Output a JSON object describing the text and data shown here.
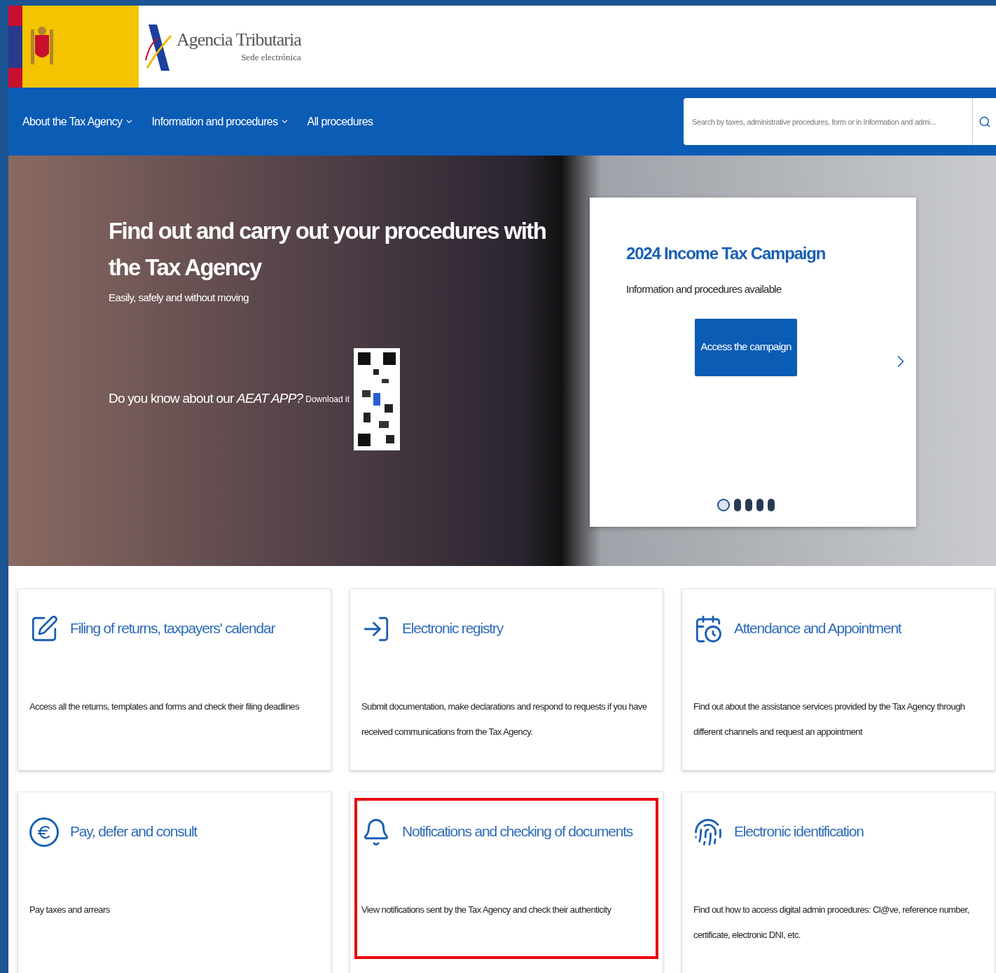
{
  "header": {
    "logo_title": "Agencia Tributaria",
    "logo_subtitle": "Sede electrónica"
  },
  "nav": {
    "items": [
      {
        "label": "About the Tax Agency",
        "has_dropdown": true
      },
      {
        "label": "Information and procedures",
        "has_dropdown": true
      },
      {
        "label": "All procedures",
        "has_dropdown": false
      }
    ],
    "search": {
      "placeholder": "Search by taxes, administrative procedures, form or in Information and admi..."
    }
  },
  "hero": {
    "title": "Find out and carry out your procedures with the Tax Agency",
    "subtitle": "Easily, safely and without moving",
    "app_prompt": "Do you know about our *AEAT APP?*",
    "download": "Download it",
    "campaign": {
      "title": "2024 Income Tax Campaign",
      "text": "Information and procedures available",
      "button": "Access the campaign",
      "dots": [
        {
          "selected": true
        },
        {
          "selected": false
        },
        {
          "selected": false
        },
        {
          "selected": false
        },
        {
          "selected": false
        }
      ]
    }
  },
  "cards": [
    {
      "kind": "pen",
      "title": "Filing of returns, taxpayers' calendar",
      "description": "Access all the returns, templates and forms and check their filing deadlines",
      "highlighted": false
    },
    {
      "kind": "registry",
      "title": "Electronic registry",
      "description": "Submit documentation, make declarations and respond to requests if you have received communications from the Tax Agency.",
      "highlighted": false
    },
    {
      "kind": "calendar",
      "title": "Attendance and Appointment",
      "description": "Find out about the assistance services provided by the Tax Agency through different channels and request an appointment",
      "highlighted": false
    },
    {
      "kind": "euro",
      "title": "Pay, defer and consult",
      "description": "Pay taxes and arrears",
      "highlighted": false
    },
    {
      "kind": "bell",
      "title": "Notifications and checking of documents",
      "description": "View notifications sent by the Tax Agency and check their authenticity",
      "highlighted": true
    },
    {
      "kind": "fingerprint",
      "title": "Electronic identification",
      "description": "Find out how to access digital admin procedures: Cl@ve, reference number, certificate, electronic DNI, etc.",
      "highlighted": false
    }
  ]
}
